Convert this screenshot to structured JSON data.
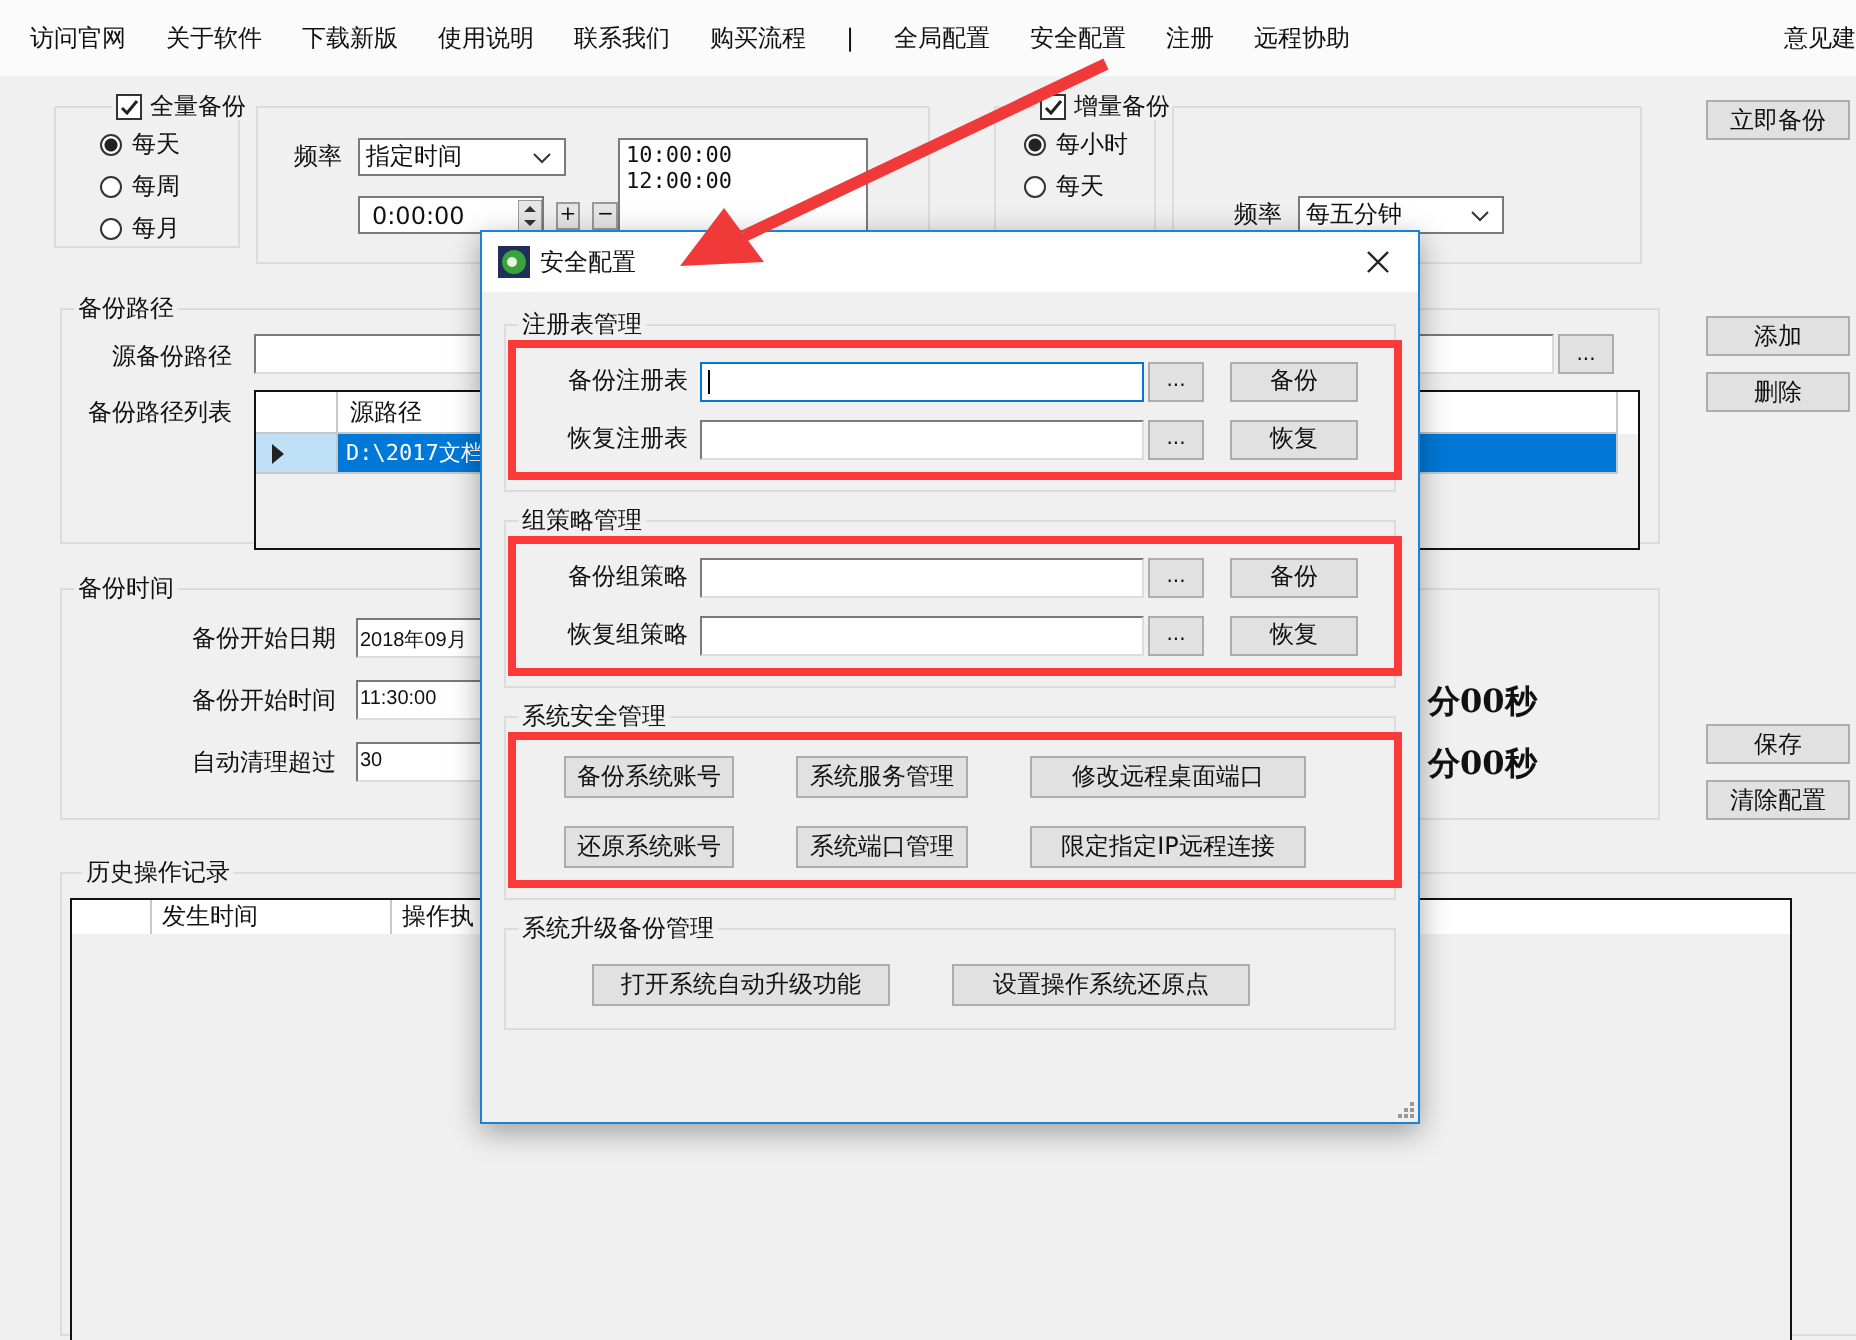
{
  "menu": [
    {
      "label": "访问官网"
    },
    {
      "label": "关于软件"
    },
    {
      "label": "下载新版"
    },
    {
      "label": "使用说明"
    },
    {
      "label": "联系我们"
    },
    {
      "label": "购买流程"
    },
    {
      "label": "|"
    },
    {
      "label": "全局配置"
    },
    {
      "label": "安全配置"
    },
    {
      "label": "注册"
    },
    {
      "label": "远程协助"
    }
  ],
  "menu_right": "意见建",
  "full_backup": {
    "label": "全量备份",
    "checked": true,
    "options": [
      {
        "label": "每天",
        "selected": true
      },
      {
        "label": "每周",
        "selected": false
      },
      {
        "label": "每月",
        "selected": false
      }
    ],
    "frequency_label": "频率",
    "frequency": "指定时间",
    "time": "0:00:00",
    "plus": "+",
    "minus": "−",
    "times": [
      "10:00:00",
      "12:00:00"
    ]
  },
  "incremental_backup": {
    "label": "增量备份",
    "checked": true,
    "options": [
      {
        "label": "每小时",
        "selected": true
      },
      {
        "label": "每天",
        "selected": false
      }
    ],
    "frequency_label": "频率",
    "frequency": "每五分钟"
  },
  "backup_now": "立即备份",
  "backup_path": {
    "title": "备份路径",
    "source_label": "源备份路径",
    "browse": "...",
    "list_label": "备份路径列表",
    "columns": [
      "源路径"
    ],
    "rows": [
      {
        "path": "D:\\2017文档",
        "selected": true
      }
    ]
  },
  "path_buttons": [
    "添加",
    "删除"
  ],
  "backup_time": {
    "title": "备份时间",
    "fields": [
      {
        "label": "备份开始日期",
        "value": "2018年09月"
      },
      {
        "label": "备份开始时间",
        "value": "11:30:00"
      },
      {
        "label": "自动清理超过",
        "value": "30"
      }
    ],
    "notes": [
      "分00秒",
      "分00秒"
    ]
  },
  "time_buttons": [
    "保存",
    "清除配置"
  ],
  "history": {
    "title": "历史操作记录",
    "columns": [
      "发生时间",
      "操作执"
    ]
  },
  "dialog": {
    "title": "安全配置",
    "groups": [
      {
        "title": "注册表管理",
        "kind": "fields",
        "highlighted": true,
        "rows": [
          {
            "label": "备份注册表",
            "browse": "...",
            "action": "备份",
            "focused": true
          },
          {
            "label": "恢复注册表",
            "browse": "...",
            "action": "恢复",
            "focused": false
          }
        ]
      },
      {
        "title": "组策略管理",
        "kind": "fields",
        "highlighted": true,
        "rows": [
          {
            "label": "备份组策略",
            "browse": "...",
            "action": "备份",
            "focused": false
          },
          {
            "label": "恢复组策略",
            "browse": "...",
            "action": "恢复",
            "focused": false
          }
        ]
      },
      {
        "title": "系统安全管理",
        "kind": "buttons",
        "highlighted": true,
        "buttons": [
          "备份系统账号",
          "系统服务管理",
          "修改远程桌面端口",
          "还原系统账号",
          "系统端口管理",
          "限定指定IP远程连接"
        ]
      },
      {
        "title": "系统升级备份管理",
        "kind": "buttons",
        "highlighted": false,
        "buttons": [
          "打开系统自动升级功能",
          "设置操作系统还原点"
        ]
      }
    ]
  }
}
